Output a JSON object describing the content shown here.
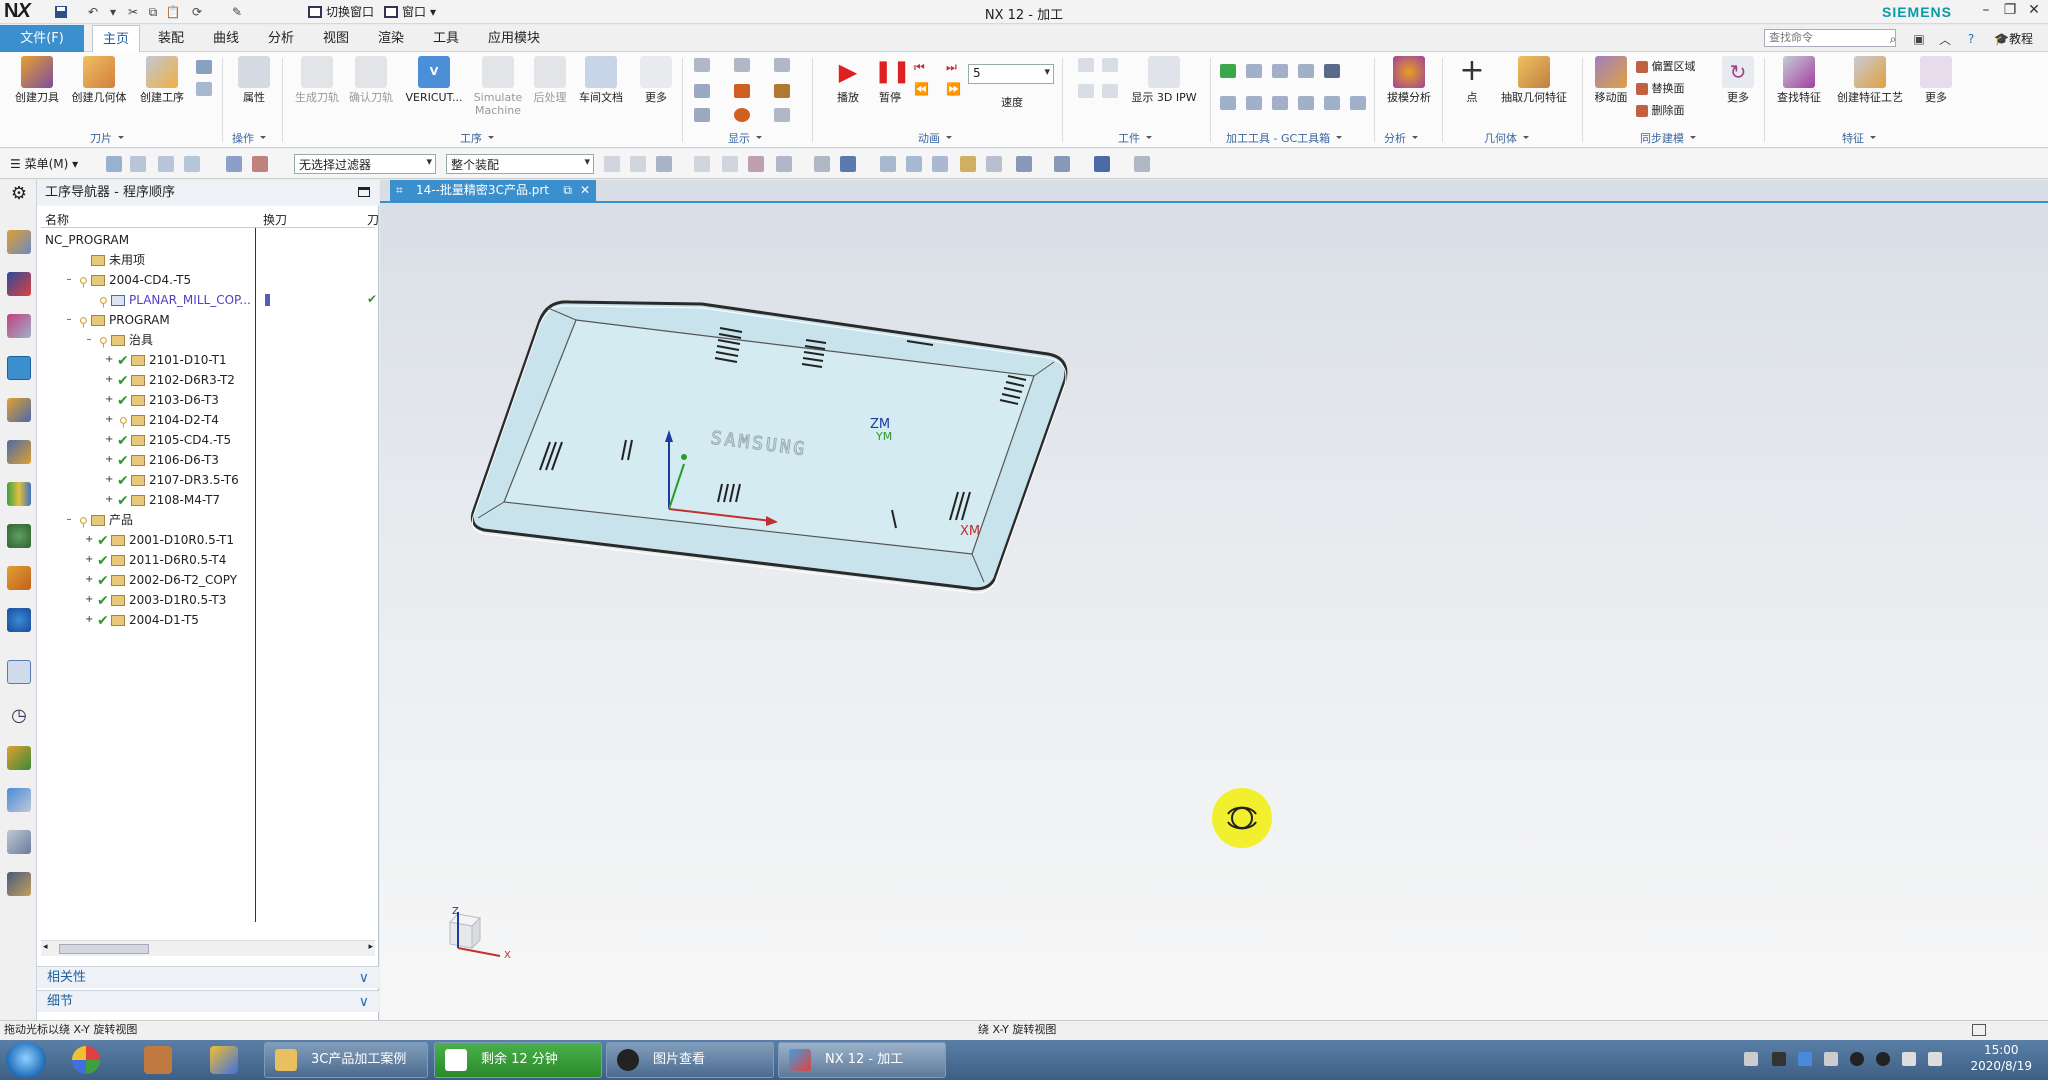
{
  "app": {
    "title": "NX 12 - 加工",
    "brand": "SIEMENS",
    "quick_toggle_window": "切换窗口",
    "quick_window": "窗口",
    "accent_color": "#3b8fcc"
  },
  "menu": {
    "file": "文件(F)",
    "tabs": [
      "主页",
      "装配",
      "曲线",
      "分析",
      "视图",
      "渲染",
      "工具",
      "应用模块"
    ],
    "active_tab": "主页",
    "search_placeholder": "查找命令",
    "help": "教程"
  },
  "ribbon": {
    "buttons": [
      {
        "label": "创建刀具",
        "icon": "create-tool-icon"
      },
      {
        "label": "创建几何体",
        "icon": "create-geometry-icon"
      },
      {
        "label": "创建工序",
        "icon": "create-operation-icon"
      },
      {
        "label": "属性",
        "icon": "properties-icon"
      },
      {
        "label": "生成刀轨",
        "icon": "generate-toolpath-icon"
      },
      {
        "label": "确认刀轨",
        "icon": "verify-toolpath-icon"
      },
      {
        "label": "VERICUT...",
        "icon": "vericut-icon"
      },
      {
        "label": "Simulate Machine",
        "icon": "simulate-machine-icon"
      },
      {
        "label": "后处理",
        "icon": "postprocess-icon"
      },
      {
        "label": "车间文档",
        "icon": "shop-doc-icon"
      },
      {
        "label": "更多",
        "icon": "more-icon"
      },
      {
        "label": "播放",
        "icon": "play-icon"
      },
      {
        "label": "暂停",
        "icon": "pause-icon"
      },
      {
        "label": "速度",
        "icon": "speed-icon"
      },
      {
        "label": "显示 3D IPW",
        "icon": "show-3d-ipw-icon"
      },
      {
        "label": "拔模分析",
        "icon": "draft-analysis-icon"
      },
      {
        "label": "点",
        "icon": "point-icon"
      },
      {
        "label": "抽取几何特征",
        "icon": "extract-geometry-icon"
      },
      {
        "label": "移动面",
        "icon": "move-face-icon"
      },
      {
        "label": "偏置区域",
        "icon": "offset-region-icon"
      },
      {
        "label": "替换面",
        "icon": "replace-face-icon"
      },
      {
        "label": "删除面",
        "icon": "delete-face-icon"
      },
      {
        "label": "更多",
        "icon": "more-icon"
      },
      {
        "label": "查找特征",
        "icon": "find-feature-icon"
      },
      {
        "label": "创建特征工艺",
        "icon": "create-feature-process-icon"
      },
      {
        "label": "更多",
        "icon": "more-icon"
      }
    ],
    "groups": [
      "刀片",
      "操作",
      "工序",
      "显示",
      "动画",
      "工件",
      "加工工具 - GC工具箱",
      "分析",
      "几何体",
      "同步建模",
      "特征"
    ],
    "speed_value": "5"
  },
  "toolbar2": {
    "menu": "菜单(M)",
    "filter": "无选择过滤器",
    "scope": "整个装配"
  },
  "navigator": {
    "title": "工序导航器 - 程序顺序",
    "columns": [
      "名称",
      "换刀",
      "刀"
    ],
    "rows": [
      {
        "label": "NC_PROGRAM",
        "indent": 0,
        "status": "none",
        "type": "root"
      },
      {
        "label": "未用项",
        "indent": 1,
        "status": "none",
        "type": "folder"
      },
      {
        "label": "2004-CD4.-T5",
        "indent": 1,
        "status": "key",
        "type": "folder"
      },
      {
        "label": "PLANAR_MILL_COP...",
        "indent": 2,
        "status": "key",
        "type": "op"
      },
      {
        "label": "PROGRAM",
        "indent": 1,
        "status": "key",
        "type": "folder"
      },
      {
        "label": "治具",
        "indent": 2,
        "status": "key",
        "type": "folder"
      },
      {
        "label": "2101-D10-T1",
        "indent": 3,
        "status": "check",
        "type": "folder"
      },
      {
        "label": "2102-D6R3-T2",
        "indent": 3,
        "status": "check",
        "type": "folder"
      },
      {
        "label": "2103-D6-T3",
        "indent": 3,
        "status": "check",
        "type": "folder"
      },
      {
        "label": "2104-D2-T4",
        "indent": 3,
        "status": "key",
        "type": "folder"
      },
      {
        "label": "2105-CD4.-T5",
        "indent": 3,
        "status": "check",
        "type": "folder"
      },
      {
        "label": "2106-D6-T3",
        "indent": 3,
        "status": "check",
        "type": "folder"
      },
      {
        "label": "2107-DR3.5-T6",
        "indent": 3,
        "status": "check",
        "type": "folder"
      },
      {
        "label": "2108-M4-T7",
        "indent": 3,
        "status": "check",
        "type": "folder"
      },
      {
        "label": "产品",
        "indent": 1,
        "status": "key",
        "type": "folder"
      },
      {
        "label": "2001-D10R0.5-T1",
        "indent": 2,
        "status": "check",
        "type": "folder"
      },
      {
        "label": "2011-D6R0.5-T4",
        "indent": 2,
        "status": "check",
        "type": "folder"
      },
      {
        "label": "2002-D6-T2_COPY",
        "indent": 2,
        "status": "check",
        "type": "folder"
      },
      {
        "label": "2003-D1R0.5-T3",
        "indent": 2,
        "status": "check",
        "type": "folder"
      },
      {
        "label": "2004-D1-T5",
        "indent": 2,
        "status": "check",
        "type": "folder"
      }
    ],
    "panels": [
      "相关性",
      "细节"
    ]
  },
  "viewport": {
    "tab": "14--批量精密3C产品.prt",
    "axis_zm": "ZM",
    "axis_ym": "YM",
    "axis_xm": "XM",
    "triad_z": "Z",
    "triad_x": "X"
  },
  "status": {
    "left": "拖动光标以绕 X-Y 旋转视图",
    "center": "绕 X-Y 旋转视图"
  },
  "taskbar": {
    "items": [
      "3C产品加工案例",
      "剩余 12 分钟",
      "图片查看",
      "NX 12 - 加工"
    ],
    "time": "15:00",
    "date": "2020/8/19"
  }
}
